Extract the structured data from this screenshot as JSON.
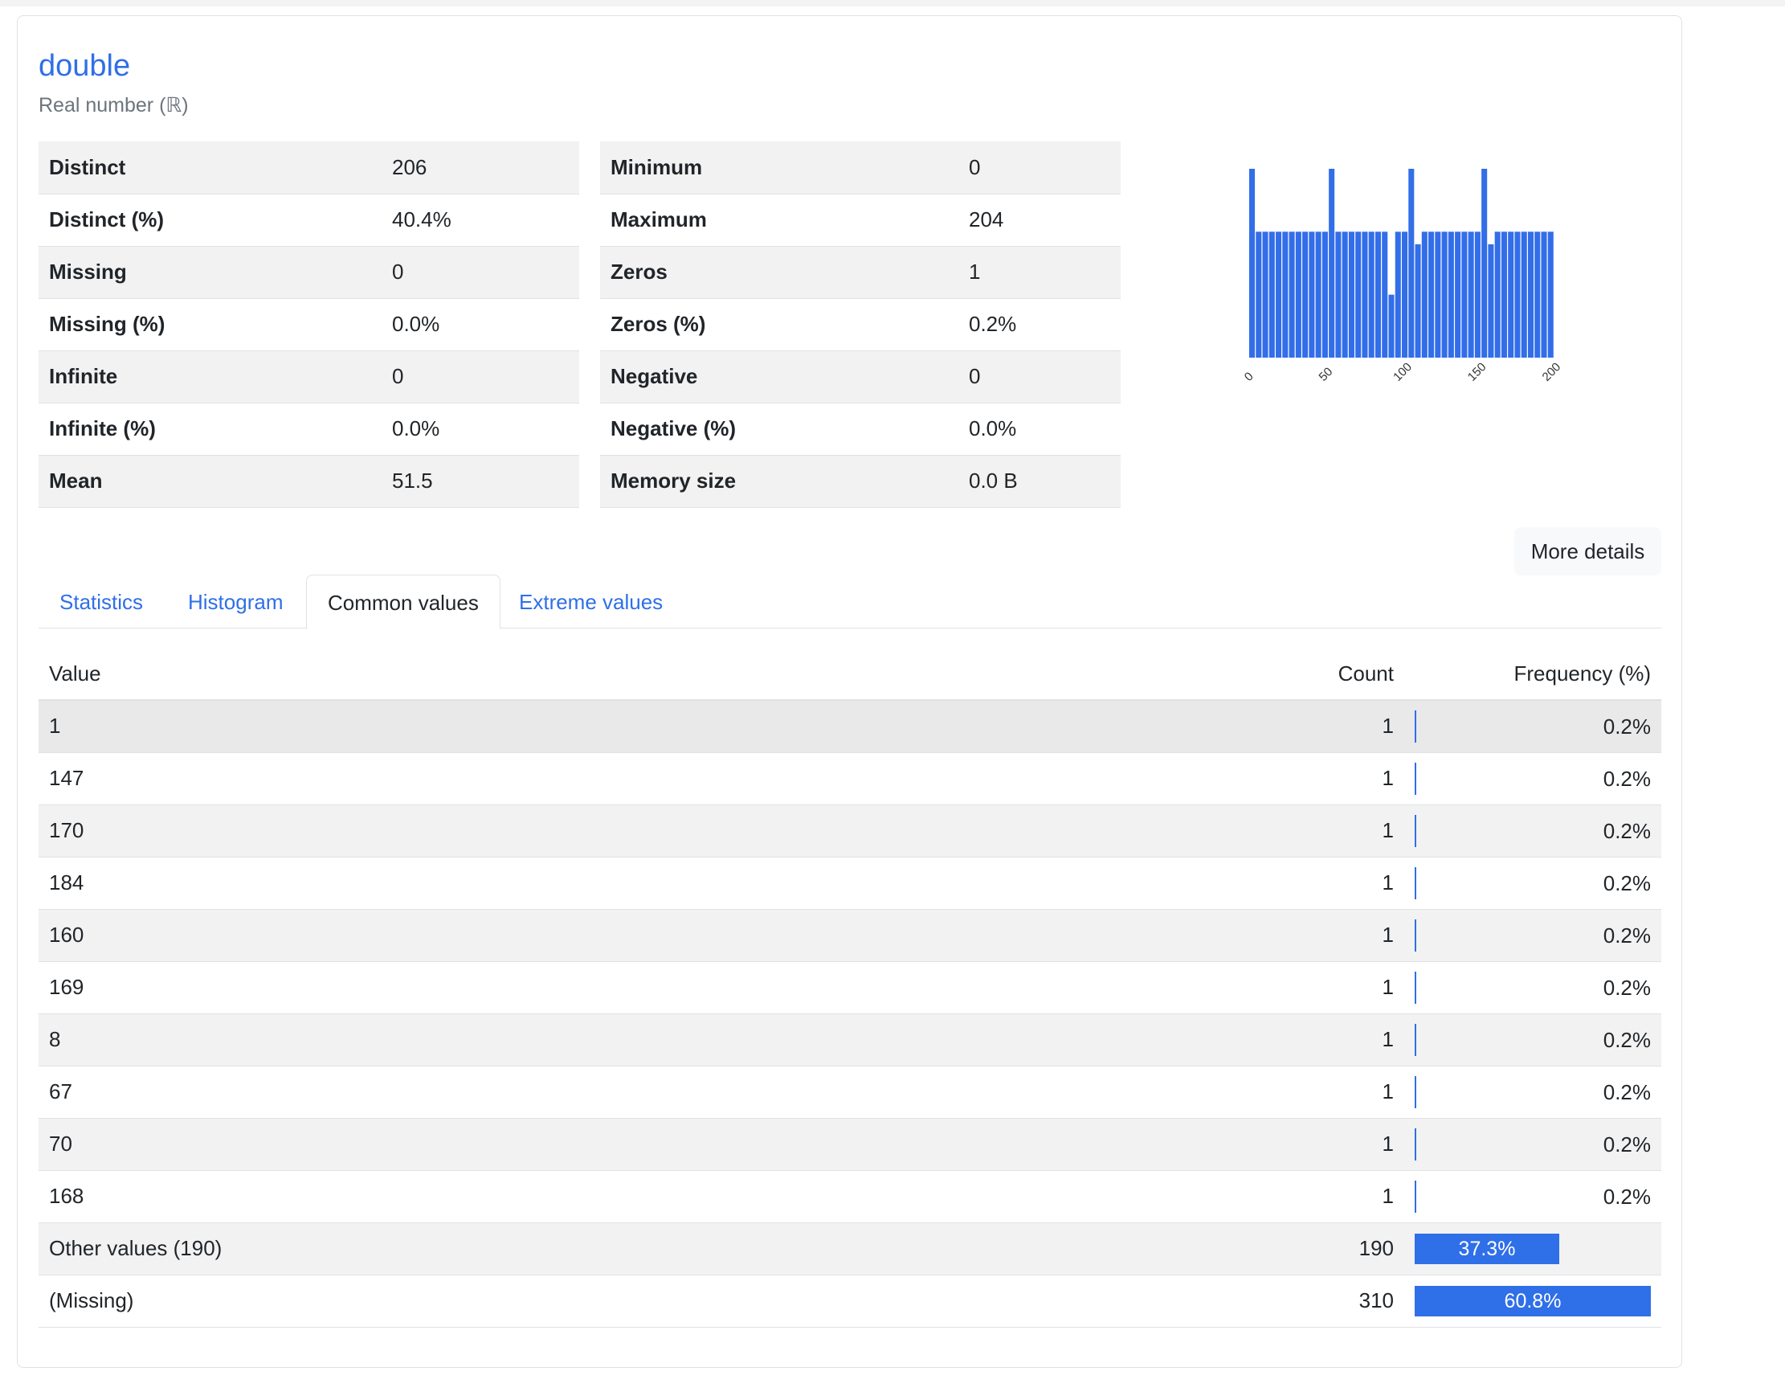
{
  "variable": {
    "name": "double",
    "type_label": "Real number (ℝ)"
  },
  "stats_left": [
    {
      "label": "Distinct",
      "value": "206"
    },
    {
      "label": "Distinct (%)",
      "value": "40.4%"
    },
    {
      "label": "Missing",
      "value": "0"
    },
    {
      "label": "Missing (%)",
      "value": "0.0%"
    },
    {
      "label": "Infinite",
      "value": "0"
    },
    {
      "label": "Infinite (%)",
      "value": "0.0%"
    },
    {
      "label": "Mean",
      "value": "51.5"
    }
  ],
  "stats_right": [
    {
      "label": "Minimum",
      "value": "0"
    },
    {
      "label": "Maximum",
      "value": "204"
    },
    {
      "label": "Zeros",
      "value": "1"
    },
    {
      "label": "Zeros (%)",
      "value": "0.2%"
    },
    {
      "label": "Negative",
      "value": "0"
    },
    {
      "label": "Negative (%)",
      "value": "0.0%"
    },
    {
      "label": "Memory size",
      "value": "0.0 B"
    }
  ],
  "more_details_label": "More details",
  "tabs": [
    {
      "label": "Statistics",
      "active": false
    },
    {
      "label": "Histogram",
      "active": false
    },
    {
      "label": "Common values",
      "active": true
    },
    {
      "label": "Extreme values",
      "active": false
    }
  ],
  "freq_table": {
    "headers": {
      "value": "Value",
      "count": "Count",
      "frequency": "Frequency (%)"
    },
    "rows": [
      {
        "value": "1",
        "count": "1",
        "freq": "0.2%",
        "fraction": 0.002
      },
      {
        "value": "147",
        "count": "1",
        "freq": "0.2%",
        "fraction": 0.002
      },
      {
        "value": "170",
        "count": "1",
        "freq": "0.2%",
        "fraction": 0.002
      },
      {
        "value": "184",
        "count": "1",
        "freq": "0.2%",
        "fraction": 0.002
      },
      {
        "value": "160",
        "count": "1",
        "freq": "0.2%",
        "fraction": 0.002
      },
      {
        "value": "169",
        "count": "1",
        "freq": "0.2%",
        "fraction": 0.002
      },
      {
        "value": "8",
        "count": "1",
        "freq": "0.2%",
        "fraction": 0.002
      },
      {
        "value": "67",
        "count": "1",
        "freq": "0.2%",
        "fraction": 0.002
      },
      {
        "value": "70",
        "count": "1",
        "freq": "0.2%",
        "fraction": 0.002
      },
      {
        "value": "168",
        "count": "1",
        "freq": "0.2%",
        "fraction": 0.002
      },
      {
        "value": "Other values (190)",
        "count": "190",
        "freq": "37.3%",
        "fraction": 0.373
      },
      {
        "value": "(Missing)",
        "count": "310",
        "freq": "60.8%",
        "fraction": 0.608
      }
    ]
  },
  "chart_data": {
    "type": "bar",
    "title": "",
    "xlabel": "",
    "ylabel": "",
    "x_ticks": [
      "0",
      "50",
      "100",
      "150",
      "200"
    ],
    "xlim": [
      0,
      205
    ],
    "bar_color": "#336ee9",
    "values": [
      3,
      2,
      2,
      2,
      2,
      2,
      2,
      2,
      2,
      2,
      2,
      2,
      3,
      2,
      2,
      2,
      2,
      2,
      2,
      2,
      2,
      1,
      2,
      2,
      3,
      1.8,
      2,
      2,
      2,
      2,
      2,
      2,
      2,
      2,
      2,
      3,
      1.8,
      2,
      2,
      2,
      2,
      2,
      2,
      2,
      2,
      2
    ],
    "ylim": [
      0,
      3
    ]
  },
  "colors": {
    "accent": "#2f6fe8",
    "row_alt": "#f2f2f2",
    "border": "#dee2e6"
  }
}
